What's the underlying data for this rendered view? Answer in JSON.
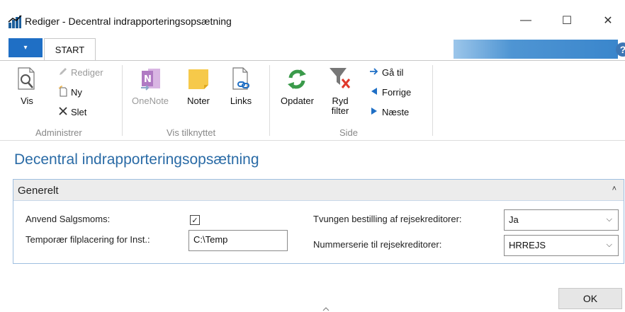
{
  "window": {
    "title": "Rediger - Decentral indrapporteringsopsætning",
    "minimize": "—",
    "maximize": "☐",
    "close": "✕",
    "app_icon": "bar-chart-icon"
  },
  "ribbon": {
    "app_menu_symbol": "▾",
    "tab_start": "START",
    "help_symbol": "?",
    "groups": {
      "administrer": {
        "label": "Administrer",
        "vis": "Vis",
        "rediger": "Rediger",
        "ny": "Ny",
        "slet": "Slet"
      },
      "vis_tilknyttet": {
        "label": "Vis tilknyttet",
        "onenote": "OneNote",
        "noter": "Noter",
        "links": "Links"
      },
      "side": {
        "label": "Side",
        "opdater": "Opdater",
        "ryd_filter_line1": "Ryd",
        "ryd_filter_line2": "filter",
        "gaa_til": "Gå til",
        "forrige": "Forrige",
        "naeste": "Næste"
      }
    }
  },
  "page": {
    "title": "Decentral indrapporteringsopsætning",
    "fasttab": {
      "title": "Generelt",
      "collapse_symbol": "˄"
    },
    "fields": {
      "anvend_salgsmoms": {
        "label": "Anvend Salgsmoms:",
        "checked": true,
        "check_symbol": "✓"
      },
      "temp_filplacering": {
        "label": "Temporær filplacering for Inst.:",
        "value": "C:\\Temp"
      },
      "tvungen_bestilling": {
        "label": "Tvungen bestilling af rejsekreditorer:",
        "value": "Ja"
      },
      "nummerserie": {
        "label": "Nummerserie til rejsekreditorer:",
        "value": "HRREJS"
      }
    },
    "chevron_symbol": "⌵"
  },
  "footer": {
    "ok_label": "OK"
  },
  "colors": {
    "accent_blue": "#1f6fc5",
    "title_blue": "#2a6ba6",
    "refresh_green": "#3a9a4a",
    "onenote_purple": "#8a3aa8",
    "note_yellow": "#f6c94a"
  }
}
